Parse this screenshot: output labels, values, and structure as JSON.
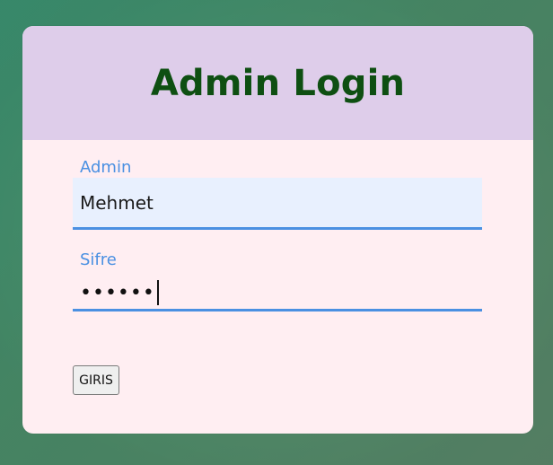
{
  "title": "Admin Login",
  "form": {
    "username": {
      "label": "Admin",
      "value": "Mehmet"
    },
    "password": {
      "label": "Sifre",
      "masked_value": "••••••"
    },
    "submit_label": "GIRIS"
  },
  "colors": {
    "background": "#4f956f",
    "card_header": "#decdea",
    "card_body": "#ffeef2",
    "title": "#0e4f12",
    "label": "#4a90e2",
    "input_bg": "#e8f0fe"
  }
}
